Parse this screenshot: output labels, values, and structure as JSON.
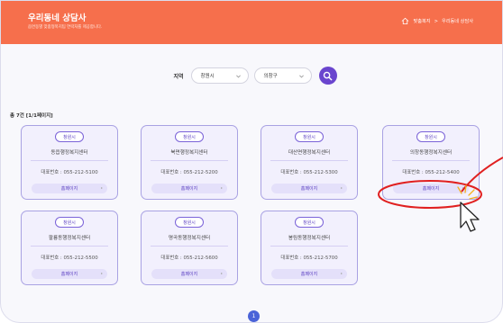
{
  "header": {
    "title": "우리동네 상담사",
    "subtitle": "읍면동별 맞춤형복지팀 연락처를 제공합니다.",
    "breadcrumb_home": "맞춤복지",
    "breadcrumb_sep": ">",
    "breadcrumb_current": "우리동네 상담사"
  },
  "search": {
    "label": "지역",
    "city_value": "창원시",
    "district_value": "의창구"
  },
  "result_count": "총 7건 [1/1페이지]",
  "cards": [
    {
      "region": "창원시",
      "name": "동읍행정복지센터",
      "phone": "대표번호 : 055-212-5100",
      "button": "홈페이지"
    },
    {
      "region": "창원시",
      "name": "북면행정복지센터",
      "phone": "대표번호 : 055-212-5200",
      "button": "홈페이지"
    },
    {
      "region": "창원시",
      "name": "대산면행정복지센터",
      "phone": "대표번호 : 055-212-5300",
      "button": "홈페이지"
    },
    {
      "region": "창원시",
      "name": "의창동행정복지센터",
      "phone": "대표번호 : 055-212-5400",
      "button": "홈페이지"
    },
    {
      "region": "창원시",
      "name": "팔룡동행정복지센터",
      "phone": "대표번호 : 055-212-5500",
      "button": "홈페이지"
    },
    {
      "region": "창원시",
      "name": "명곡동행정복지센터",
      "phone": "대표번호 : 055-212-5600",
      "button": "홈페이지"
    },
    {
      "region": "창원시",
      "name": "봉림동행정복지센터",
      "phone": "대표번호 : 055-212-5700",
      "button": "홈페이지"
    }
  ],
  "pagination": {
    "current": "1"
  },
  "colors": {
    "header_bg": "#f66f4c",
    "accent_purple": "#6a45ce",
    "card_bg": "#f2f0fd",
    "pager_blue": "#4a63d8",
    "annotation_red": "#e02020"
  },
  "icons": {
    "home": "home-icon",
    "dropdown": "chevron-down-icon",
    "search": "search-icon",
    "card_link": "chevron-right-icon",
    "pointer": "cursor-pointer-icon"
  }
}
